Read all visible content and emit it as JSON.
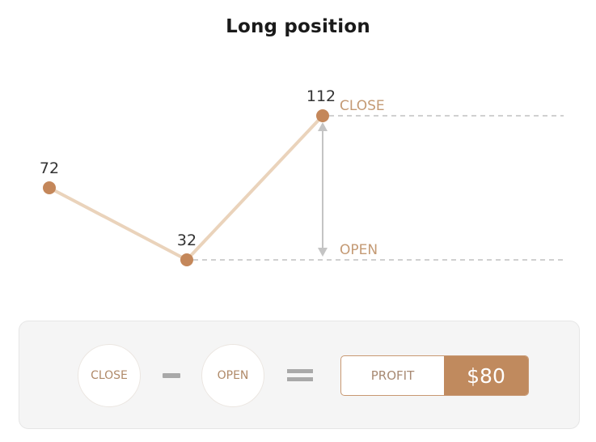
{
  "title": "Long position",
  "colors": {
    "accent": "#c08a5e",
    "line": "#ead3bb",
    "dot": "#c4875a",
    "tag_text": "#c49a74",
    "dashed": "#b5b5b5",
    "arrow": "#c4c4c4"
  },
  "chart_data": {
    "type": "line",
    "title": "Long position",
    "points": [
      {
        "label": "72",
        "value": 72
      },
      {
        "label": "32",
        "value": 32
      },
      {
        "label": "112",
        "value": 112
      }
    ],
    "annotations": [
      {
        "text": "CLOSE",
        "value": 112
      },
      {
        "text": "OPEN",
        "value": 32
      }
    ],
    "arrow": {
      "from": 32,
      "to": 112,
      "bidirectional": true
    }
  },
  "formula": {
    "term1": "CLOSE",
    "operator1": "minus",
    "term2": "OPEN",
    "operator2": "equals",
    "result_label": "PROFIT",
    "result_value": "$80"
  }
}
